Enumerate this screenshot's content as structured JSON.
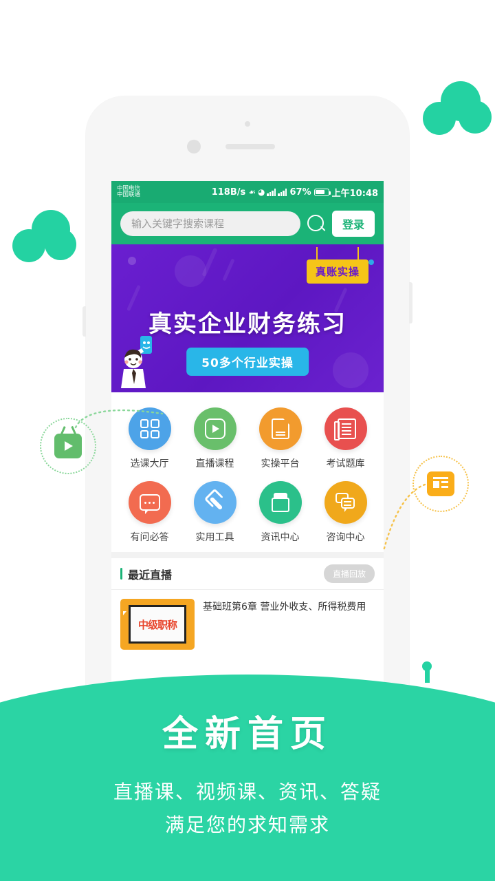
{
  "theme": {
    "brand_green": "#1BB377",
    "status_green": "#19AB72",
    "bottom_green": "#2BD4A4",
    "decor_green": "#24D2A2",
    "banner_purple": "#5D17C2",
    "badge_yellow": "#F5C518",
    "sub_blue": "#29B6E8"
  },
  "statusbar": {
    "carrier1": "中国电信",
    "carrier2": "中国联通",
    "netspeed": "118B/s",
    "bluetooth_icon": "bluetooth-icon",
    "wifi_icon": "wifi-icon",
    "signal_icon": "signal-bars-icon",
    "battery_pct": "67%",
    "time": "上午10:48"
  },
  "search": {
    "placeholder": "输入关键字搜索课程",
    "value": "",
    "search_icon": "search-icon",
    "login_label": "登录"
  },
  "banner": {
    "badge": "真账实操",
    "title": "真实企业财务练习",
    "subtitle": "50多个行业实操"
  },
  "grid": {
    "items": [
      {
        "label": "选课大厅",
        "color": "#4DA3E8",
        "icon": "grid-four-icon"
      },
      {
        "label": "直播课程",
        "color": "#69BF6B",
        "icon": "play-icon"
      },
      {
        "label": "实操平台",
        "color": "#F29B2E",
        "icon": "document-icon"
      },
      {
        "label": "考试题库",
        "color": "#E8504F",
        "icon": "list-book-icon"
      },
      {
        "label": "有问必答",
        "color": "#F26B50",
        "icon": "chat-bubble-icon"
      },
      {
        "label": "实用工具",
        "color": "#63B2F0",
        "icon": "wrench-icon"
      },
      {
        "label": "资讯中心",
        "color": "#2BC08A",
        "icon": "jar-icon"
      },
      {
        "label": "咨询中心",
        "color": "#F0A81B",
        "icon": "messages-icon"
      }
    ]
  },
  "live": {
    "section_title": "最近直播",
    "replay_label": "直播回放",
    "course": {
      "thumb_text": "中级职称",
      "title": "基础班第6章 营业外收支、所得税费用"
    }
  },
  "callouts": {
    "left_icon": "tv-play-icon",
    "right_icon": "news-article-icon"
  },
  "promo": {
    "headline": "全新首页",
    "line1": "直播课、视频课、资讯、答疑",
    "line2": "满足您的求知需求"
  }
}
